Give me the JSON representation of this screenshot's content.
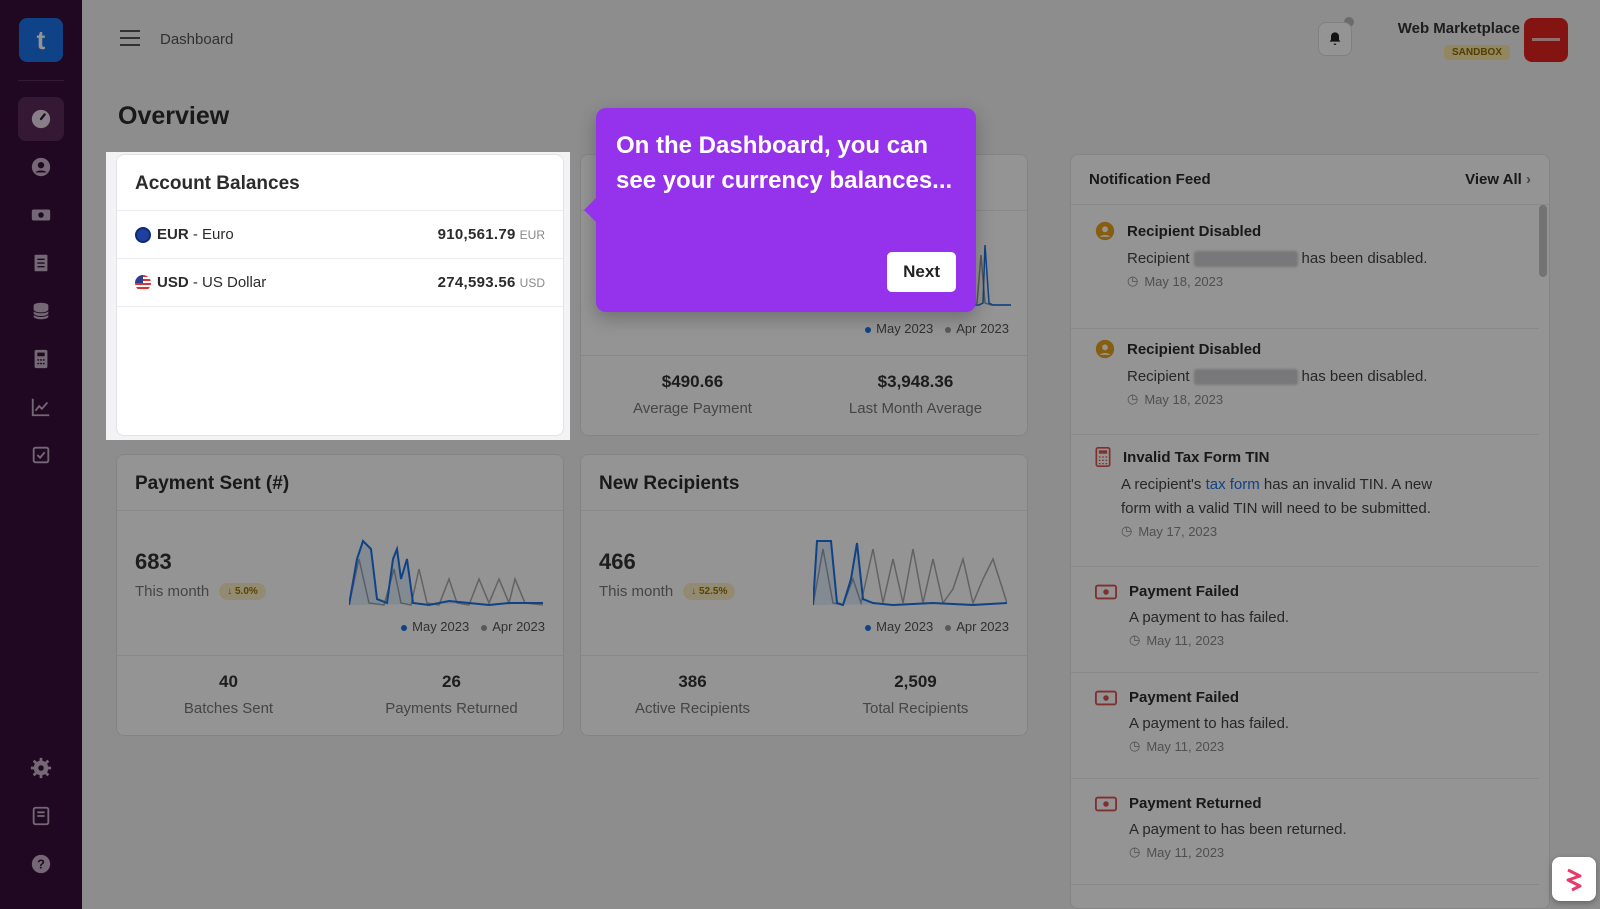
{
  "sidebar": {
    "logo_letter": "t",
    "nav": [
      "dashboard-icon",
      "user-icon",
      "money-icon",
      "receipt-icon",
      "database-icon",
      "calculator-icon",
      "chart-icon",
      "checkbox-icon"
    ],
    "bottom": [
      "gear-icon",
      "book-icon",
      "help-icon"
    ]
  },
  "header": {
    "breadcrumb": "Dashboard",
    "account_name": "Web Marketplace",
    "environment": "SANDBOX"
  },
  "page": {
    "title": "Overview"
  },
  "balances": {
    "title": "Account Balances",
    "rows": [
      {
        "code": "EUR",
        "name": " - Euro",
        "amount": "910,561.79",
        "unit": "EUR"
      },
      {
        "code": "USD",
        "name": " - US Dollar",
        "amount": "274,593.56",
        "unit": "USD"
      }
    ]
  },
  "payments_card": {
    "legend_current": "May 2023",
    "legend_previous": "Apr 2023",
    "avg_value": "$490.66",
    "avg_label": "Average Payment",
    "last_value": "$3,948.36",
    "last_label": "Last Month Average"
  },
  "sent_card": {
    "title": "Payment Sent (#)",
    "value": "683",
    "sub": "This month",
    "change": "5.0%",
    "legend_current": "May 2023",
    "legend_previous": "Apr 2023",
    "stat1_value": "40",
    "stat1_label": "Batches Sent",
    "stat2_value": "26",
    "stat2_label": "Payments Returned"
  },
  "recipients_card": {
    "title": "New Recipients",
    "value": "466",
    "sub": "This month",
    "change": "52.5%",
    "legend_current": "May 2023",
    "legend_previous": "Apr 2023",
    "stat1_value": "386",
    "stat1_label": "Active Recipients",
    "stat2_value": "2,509",
    "stat2_label": "Total Recipients"
  },
  "feed": {
    "title": "Notification Feed",
    "view_all": "View All",
    "items": [
      {
        "title": "Recipient Disabled",
        "body_pre": "Recipient",
        "body_post": "has been disabled.",
        "date": "May 18, 2023"
      },
      {
        "title": "Recipient Disabled",
        "body_pre": "Recipient",
        "body_post": "has been disabled.",
        "date": "May 18, 2023"
      },
      {
        "title": "Invalid Tax Form TIN",
        "body_pre": "A recipient's ",
        "link": "tax form",
        "body_post": " has an invalid TIN. A new form with a valid TIN will need to be submitted.",
        "date": "May 17, 2023"
      },
      {
        "title": "Payment Failed",
        "body": "A payment to has failed.",
        "date": "May 11, 2023"
      },
      {
        "title": "Payment Failed",
        "body": "A payment to has failed.",
        "date": "May 11, 2023"
      },
      {
        "title": "Payment Returned",
        "body": "A payment to has been returned.",
        "date": "May 11, 2023"
      }
    ]
  },
  "tooltip": {
    "text": "On the Dashboard, you can see your currency balances...",
    "button": "Next"
  },
  "colors": {
    "accent": "#9533ec",
    "brand": "#1a73e8",
    "sidebar": "#3a0f3b",
    "series_current": "#1a73e8",
    "series_previous": "#999999"
  }
}
